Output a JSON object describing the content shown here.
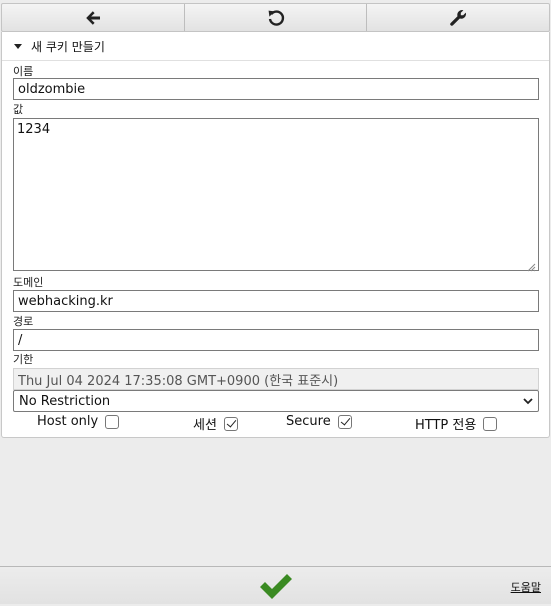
{
  "toolbar": {
    "back_icon": "arrow-left-icon",
    "reload_icon": "refresh-icon",
    "settings_icon": "wrench-icon"
  },
  "section": {
    "title": "새 쿠키 만들기"
  },
  "form": {
    "name_label": "이름",
    "name_value": "oldzombie",
    "value_label": "값",
    "value_value": "1234",
    "domain_label": "도메인",
    "domain_value": "webhacking.kr",
    "path_label": "경로",
    "path_value": "/",
    "expires_label": "기한",
    "expires_value": "Thu Jul 04 2024 17:35:08 GMT+0900 (한국 표준시)",
    "restriction_selected": "No Restriction"
  },
  "flags": {
    "host_only_label": "Host only",
    "host_only_checked": false,
    "session_label": "세션",
    "session_checked": true,
    "secure_label": "Secure",
    "secure_checked": true,
    "http_only_label": "HTTP 전용",
    "http_only_checked": false
  },
  "footer": {
    "confirm_icon": "checkmark-icon",
    "help_label": "도움말"
  },
  "colors": {
    "confirm_green": "#3a8a22"
  }
}
